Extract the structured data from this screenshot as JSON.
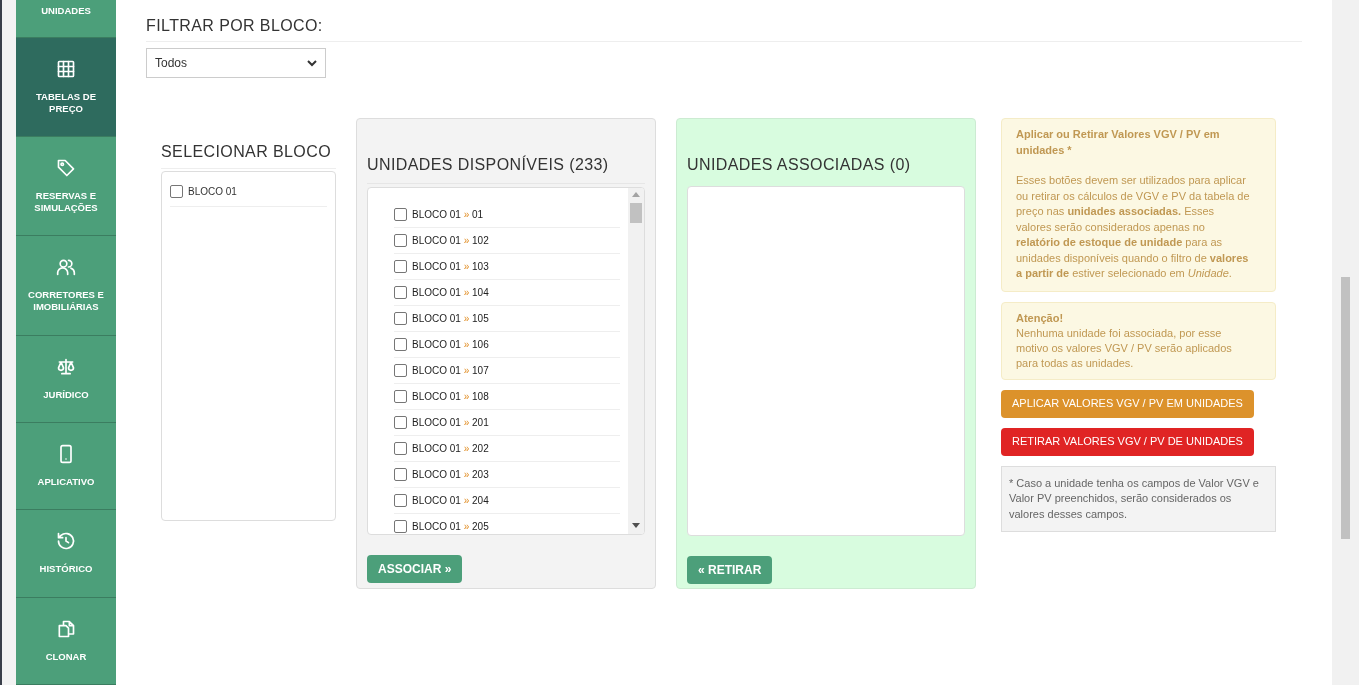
{
  "sidebar": {
    "items": [
      {
        "label": "UNIDADES",
        "selected": false
      },
      {
        "label": "TABELAS DE PREÇO",
        "selected": true
      },
      {
        "label": "RESERVAS E SIMULAÇÕES",
        "selected": false
      },
      {
        "label": "CORRETORES E IMOBILIÁRIAS",
        "selected": false
      },
      {
        "label": "JURÍDICO",
        "selected": false
      },
      {
        "label": "APLICATIVO",
        "selected": false
      },
      {
        "label": "HISTÓRICO",
        "selected": false
      },
      {
        "label": "CLONAR",
        "selected": false
      }
    ]
  },
  "filter": {
    "title": "FILTRAR POR BLOCO:",
    "value": "Todos"
  },
  "blocks": {
    "title": "SELECIONAR BLOCO",
    "items": [
      {
        "label": "BLOCO 01",
        "checked": false
      }
    ]
  },
  "available": {
    "title": "UNIDADES DISPONÍVEIS (233)",
    "button": "ASSOCIAR »",
    "units": [
      {
        "block": "BLOCO 01",
        "sep": "»",
        "number": "01",
        "checked": false
      },
      {
        "block": "BLOCO 01",
        "sep": "»",
        "number": "102",
        "checked": false
      },
      {
        "block": "BLOCO 01",
        "sep": "»",
        "number": "103",
        "checked": false
      },
      {
        "block": "BLOCO 01",
        "sep": "»",
        "number": "104",
        "checked": false
      },
      {
        "block": "BLOCO 01",
        "sep": "»",
        "number": "105",
        "checked": false
      },
      {
        "block": "BLOCO 01",
        "sep": "»",
        "number": "106",
        "checked": false
      },
      {
        "block": "BLOCO 01",
        "sep": "»",
        "number": "107",
        "checked": false
      },
      {
        "block": "BLOCO 01",
        "sep": "»",
        "number": "108",
        "checked": false
      },
      {
        "block": "BLOCO 01",
        "sep": "»",
        "number": "201",
        "checked": false
      },
      {
        "block": "BLOCO 01",
        "sep": "»",
        "number": "202",
        "checked": false
      },
      {
        "block": "BLOCO 01",
        "sep": "»",
        "number": "203",
        "checked": false
      },
      {
        "block": "BLOCO 01",
        "sep": "»",
        "number": "204",
        "checked": false
      },
      {
        "block": "BLOCO 01",
        "sep": "»",
        "number": "205",
        "checked": false
      }
    ]
  },
  "associated": {
    "title": "UNIDADES ASSOCIADAS (0)",
    "button": "« RETIRAR"
  },
  "info": {
    "title": "Aplicar ou Retirar Valores VGV / PV em unidades *",
    "body": "Esses botões devem ser utilizados para aplicar ou retirar os cálculos de VGV e PV da tabela de preço nas **unidades associadas.** Esses valores serão considerados apenas no **relatório de estoque de unidade** para as unidades disponíveis quando o filtro de **valores a partir de** estiver selecionado em *Unidade*.",
    "warning_title": "Atenção!",
    "warning_body": "Nenhuma unidade foi associada, por esse motivo os valores VGV / PV serão aplicados para todas as unidades.",
    "buttons": [
      {
        "label": "APLICAR VALORES VGV / PV EM UNIDADES",
        "kind": "apply"
      },
      {
        "label": "RETIRAR VALORES VGV / PV DE UNIDADES",
        "kind": "remove"
      }
    ],
    "note": "* Caso a unidade tenha os campos de Valor VGV e Valor PV preenchidos, serão considerados os valores desses campos."
  }
}
